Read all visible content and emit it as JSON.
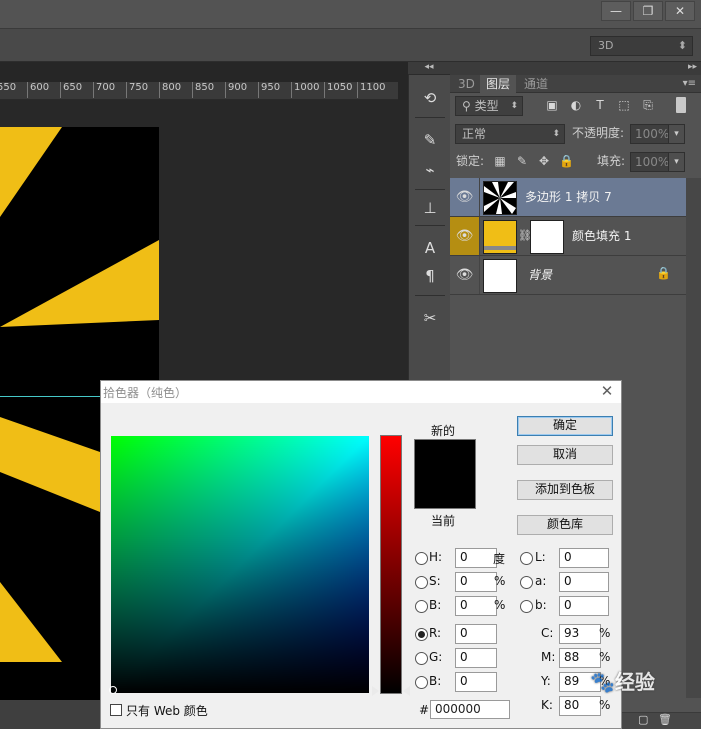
{
  "menubar": {
    "window_controls": [
      "—",
      "❐",
      "✕"
    ],
    "mode_3d": "3D"
  },
  "ruler": {
    "ticks": [
      "550",
      "600",
      "650",
      "700",
      "750",
      "800",
      "850",
      "900",
      "950",
      "1000",
      "1050",
      "1100"
    ]
  },
  "layers_panel": {
    "tabs": [
      "3D",
      "图层",
      "通道"
    ],
    "active_tab": "图层",
    "filter_label": "类型",
    "blend_mode": "正常",
    "opacity_label": "不透明度:",
    "opacity_value": "100%",
    "lock_label": "锁定:",
    "fill_label": "填充:",
    "fill_value": "100%",
    "layers": [
      {
        "name": "多边形 1 拷贝 7",
        "selected": true
      },
      {
        "name": "颜色填充 1",
        "selected": false
      },
      {
        "name": "背景",
        "selected": false,
        "locked": true
      }
    ]
  },
  "color_picker": {
    "title": "拾色器（纯色）",
    "new_label": "新的",
    "current_label": "当前",
    "buttons": {
      "ok": "确定",
      "cancel": "取消",
      "add_swatch": "添加到色板",
      "libraries": "颜色库"
    },
    "fields": {
      "H": "0",
      "S": "0",
      "B": "0",
      "R": "0",
      "G": "0",
      "B2": "0",
      "L": "0",
      "a": "0",
      "b": "0",
      "C": "93",
      "M": "88",
      "Y": "89",
      "K": "80"
    },
    "field_labels": {
      "H": "H:",
      "S": "S:",
      "B": "B:",
      "R": "R:",
      "G": "G:",
      "B2": "B:",
      "L": "L:",
      "a": "a:",
      "b": "b:",
      "C": "C:",
      "M": "M:",
      "Y": "Y:",
      "K": "K:"
    },
    "units": {
      "deg": "度",
      "pct": "%"
    },
    "web_only_label": "只有 Web 颜色",
    "hash": "#",
    "hex": "000000",
    "selected_color": "#000000",
    "hue_color": "#ff0000"
  },
  "watermark": "经验",
  "colors": {
    "accent_gold": "#f0be16",
    "selection_blue": "#6b7a94"
  }
}
